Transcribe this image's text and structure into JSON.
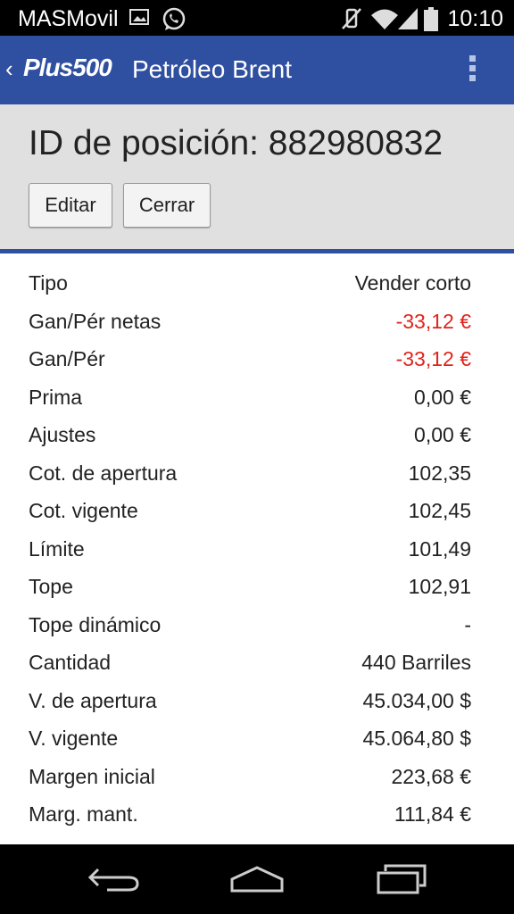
{
  "status": {
    "carrier": "MASMovil",
    "time": "10:10",
    "icons": [
      "image-icon",
      "whatsapp-icon",
      "mute-vibrate-icon",
      "wifi-icon",
      "signal-icon",
      "battery-icon"
    ]
  },
  "appbar": {
    "logo": "Plus500",
    "title": "Petróleo Brent",
    "accent": "#2f4fa0"
  },
  "position": {
    "id_text": "ID de posición: 882980832",
    "edit_label": "Editar",
    "close_label": "Cerrar"
  },
  "details": [
    {
      "label": "Tipo",
      "value": "Vender corto",
      "negative": false
    },
    {
      "label": "Gan/Pér netas",
      "value": "-33,12 €",
      "negative": true
    },
    {
      "label": "Gan/Pér",
      "value": "-33,12 €",
      "negative": true
    },
    {
      "label": "Prima",
      "value": "0,00 €",
      "negative": false
    },
    {
      "label": "Ajustes",
      "value": "0,00 €",
      "negative": false
    },
    {
      "label": "Cot. de apertura",
      "value": "102,35",
      "negative": false
    },
    {
      "label": "Cot. vigente",
      "value": "102,45",
      "negative": false
    },
    {
      "label": "Límite",
      "value": "101,49",
      "negative": false
    },
    {
      "label": "Tope",
      "value": "102,91",
      "negative": false
    },
    {
      "label": "Tope dinámico",
      "value": "-",
      "negative": false
    },
    {
      "label": "Cantidad",
      "value": "440 Barriles",
      "negative": false
    },
    {
      "label": "V. de apertura",
      "value": "45.034,00 $",
      "negative": false
    },
    {
      "label": "V. vigente",
      "value": "45.064,80 $",
      "negative": false
    },
    {
      "label": "Margen inicial",
      "value": "223,68 €",
      "negative": false
    },
    {
      "label": "Marg. mant.",
      "value": "111,84 €",
      "negative": false
    }
  ],
  "colors": {
    "negative": "#e0241b",
    "header_bg": "#e0e0e0"
  },
  "nav": {
    "icons": [
      "back-icon",
      "home-icon",
      "recents-icon"
    ]
  }
}
